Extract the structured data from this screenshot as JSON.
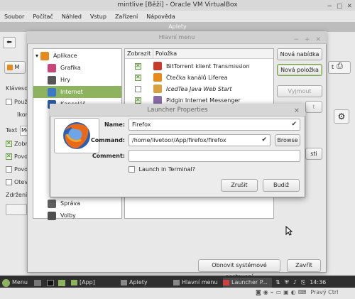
{
  "vbox": {
    "title": "mintlive [Běží] - Oracle VM VirtualBox",
    "menu": [
      "Soubor",
      "Počítač",
      "Náhled",
      "Vstup",
      "Zařízení",
      "Nápověda"
    ],
    "status_host_key": "Pravý Ctrl"
  },
  "background_window": {
    "title": "Aplety",
    "left_labels": [
      "Klávesov",
      "Použ",
      "Ikon",
      "Text",
      "Zobr",
      "Povo",
      "Povo",
      "Otev",
      "Zdržení z"
    ],
    "text_value": "Me",
    "button_prefix": "M"
  },
  "main_menu": {
    "title": "Hlavní menu",
    "categories": [
      {
        "label": "Aplikace",
        "color": "#e68a1e",
        "selected": false,
        "root": true
      },
      {
        "label": "Grafika",
        "color": "#c9467a",
        "selected": false
      },
      {
        "label": "Hry",
        "color": "#555555",
        "selected": false
      },
      {
        "label": "Internet",
        "color": "#3c78c8",
        "selected": true
      },
      {
        "label": "Kancelář",
        "color": "#2a5aa8",
        "selected": false
      },
      {
        "label": "Správa",
        "color": "#606060",
        "selected": false
      },
      {
        "label": "Volby",
        "color": "#505050",
        "selected": false
      }
    ],
    "columns": [
      "Zobrazit",
      "Položka"
    ],
    "items": [
      {
        "label": "BitTorrent klient Transmission",
        "checked": true,
        "color": "#c83a2a"
      },
      {
        "label": "Čtečka kanálů Liferea",
        "checked": true,
        "color": "#e88a1a"
      },
      {
        "label": "IcedTea Java Web Start",
        "checked": false,
        "color": "#d8a040",
        "italic": true
      },
      {
        "label": "Pidgin Internet Messenger",
        "checked": true,
        "color": "#8a6aa8"
      }
    ],
    "buttons": {
      "new_menu": "Nová nabídka",
      "new_item": "Nová položka",
      "cut": "Vyjmout",
      "partial1": "t",
      "partial2": "sti",
      "restore": "Obnovit systémové nastavení",
      "close": "Zavřít"
    }
  },
  "launcher": {
    "title": "Launcher Properties",
    "name_label": "Name:",
    "name_value": "Firefox",
    "command_label": "Command:",
    "command_value": "/home/livetoor/App/firefox/firefox",
    "browse": "Browse",
    "comment_label": "Comment:",
    "comment_value": "",
    "terminal_label": "Launch in Terminal?",
    "terminal_checked": false,
    "cancel": "Zrušit",
    "ok": "Budiž",
    "icon": "firefox-icon"
  },
  "taskbar": {
    "menu_label": "Menu",
    "items": [
      "[App]",
      "Aplety",
      "Hlavní menu",
      "Launcher P..."
    ],
    "clock": "14:36"
  },
  "colors": {
    "accent": "#8eb35e",
    "taskbar": "#2f2f2f"
  }
}
